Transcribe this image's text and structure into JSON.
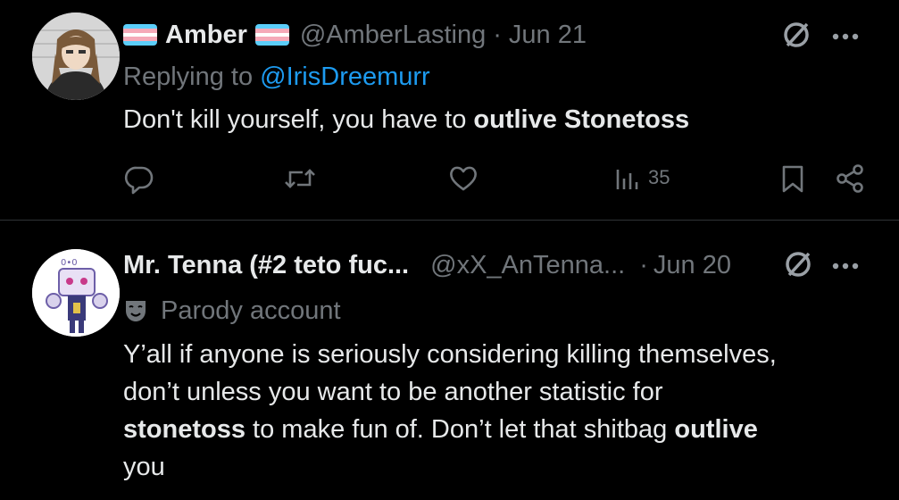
{
  "tweets": [
    {
      "display_name": "Amber",
      "handle": "@AmberLasting",
      "separator": "·",
      "date": "Jun 21",
      "reply_prefix": "Replying to ",
      "reply_handle": "@IrisDreemurr",
      "text_parts": [
        "Don't kill yourself, you have to ",
        "outlive Stonetoss"
      ],
      "views": "35"
    },
    {
      "display_name": "Mr. Tenna (#2 teto fuc...",
      "handle": "@xX_AnTenna...",
      "separator": "·",
      "date": "Jun 20",
      "parody_label": "Parody account",
      "text_lines": [
        "Y’all if anyone is seriously considering killing themselves,",
        "don’t unless you want to be another statistic for"
      ],
      "text_bold_1": "stonetoss",
      "text_mid": " to make fun of. Don’t let that shitbag ",
      "text_bold_2": "outlive",
      "text_end": "you"
    }
  ],
  "icons": {
    "no_retweet": "circle-slash-icon",
    "more": "more-icon",
    "reply": "reply-icon",
    "retweet": "retweet-icon",
    "like": "heart-icon",
    "views": "views-icon",
    "bookmark": "bookmark-icon",
    "share": "share-icon",
    "parody": "parody-mask-icon"
  },
  "colors": {
    "background": "#000000",
    "text": "#e7e9ea",
    "muted": "#71767b",
    "link": "#1d9bf0",
    "flag_blue": "#5BCEFA",
    "flag_pink": "#F5A9B8",
    "flag_white": "#FFFFFF"
  }
}
